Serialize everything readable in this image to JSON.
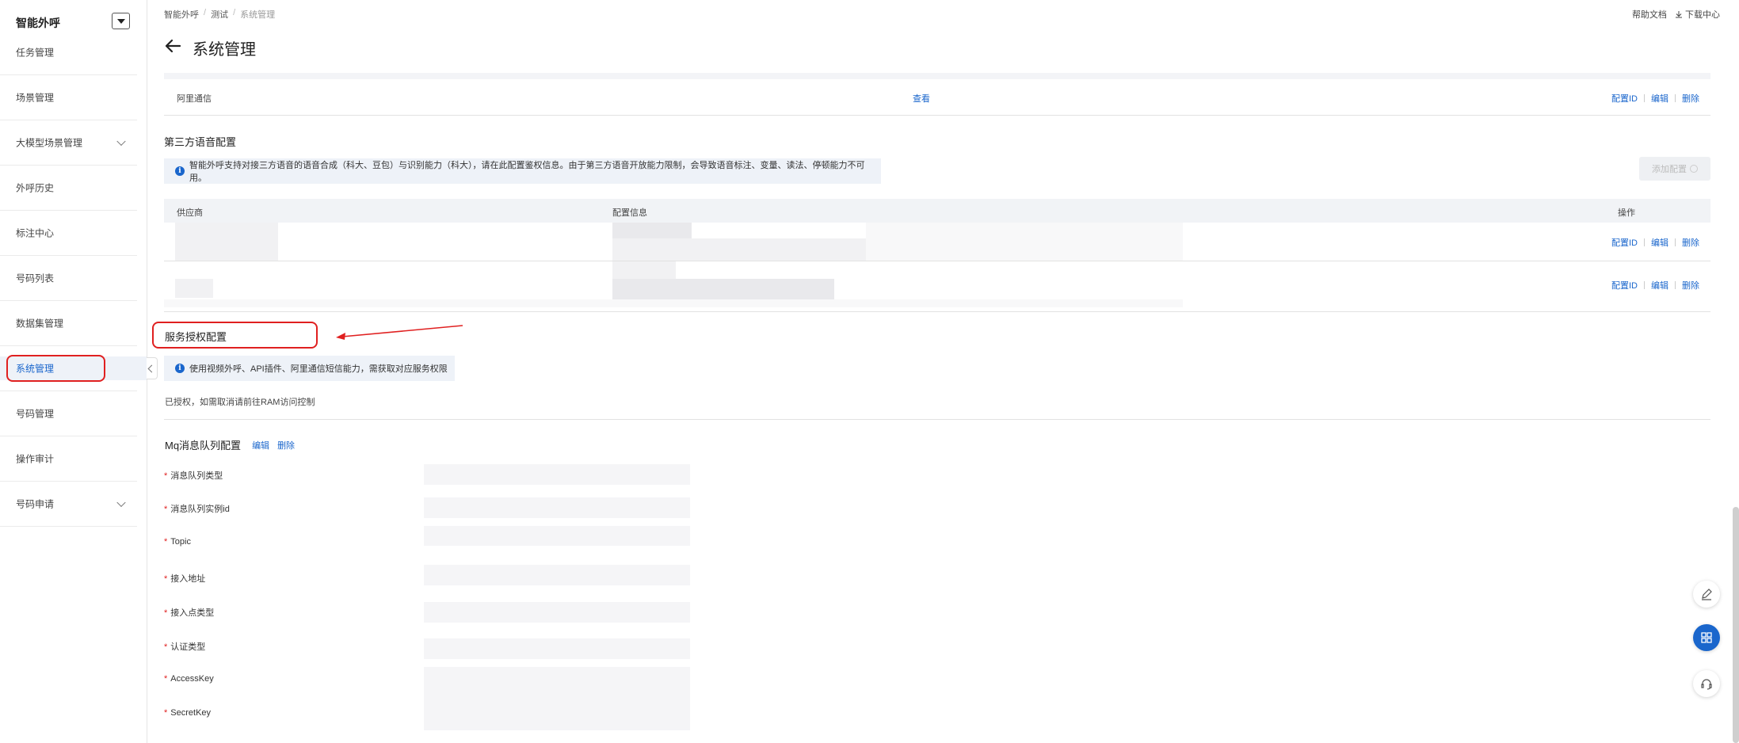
{
  "sidebar": {
    "title": "智能外呼",
    "items": [
      {
        "label": "任务管理"
      },
      {
        "label": "场景管理"
      },
      {
        "label": "大模型场景管理"
      },
      {
        "label": "外呼历史"
      },
      {
        "label": "标注中心"
      },
      {
        "label": "号码列表"
      },
      {
        "label": "数据集管理"
      },
      {
        "label": "系统管理"
      },
      {
        "label": "号码管理"
      },
      {
        "label": "操作审计"
      },
      {
        "label": "号码申请"
      }
    ]
  },
  "breadcrumb": [
    "智能外呼",
    "测试",
    "系统管理"
  ],
  "topbar": {
    "help": "帮助文档",
    "download": "下载中心"
  },
  "page_title": "系统管理",
  "row_aliyun": {
    "name": "阿里通信",
    "view": "查看"
  },
  "ops": {
    "config_id": "配置ID",
    "edit": "编辑",
    "delete": "删除"
  },
  "third_party": {
    "title": "第三方语音配置",
    "info": "智能外呼支持对接三方语音的语音合成（科大、豆包）与识别能力（科大），请在此配置鉴权信息。由于第三方语音开放能力限制，会导致语音标注、变量、读法、停顿能力不可用。",
    "add_button": "添加配置",
    "col_vendor": "供应商",
    "col_config": "配置信息",
    "col_ops": "操作"
  },
  "auth": {
    "title": "服务授权配置",
    "info": "使用视频外呼、API插件、阿里通信短信能力，需获取对应服务权限",
    "status": "已授权，如需取消请前往RAM访问控制"
  },
  "mq": {
    "title": "Mq消息队列配置",
    "edit": "编辑",
    "delete": "删除",
    "fields": [
      {
        "label": "消息队列类型"
      },
      {
        "label": "消息队列实例id"
      },
      {
        "label": "Topic"
      },
      {
        "label": "接入地址"
      },
      {
        "label": "接入点类型"
      },
      {
        "label": "认证类型"
      },
      {
        "label": "AccessKey"
      },
      {
        "label": "SecretKey"
      }
    ]
  },
  "colors": {
    "accent": "#1a66cc",
    "highlight": "#e02020"
  }
}
